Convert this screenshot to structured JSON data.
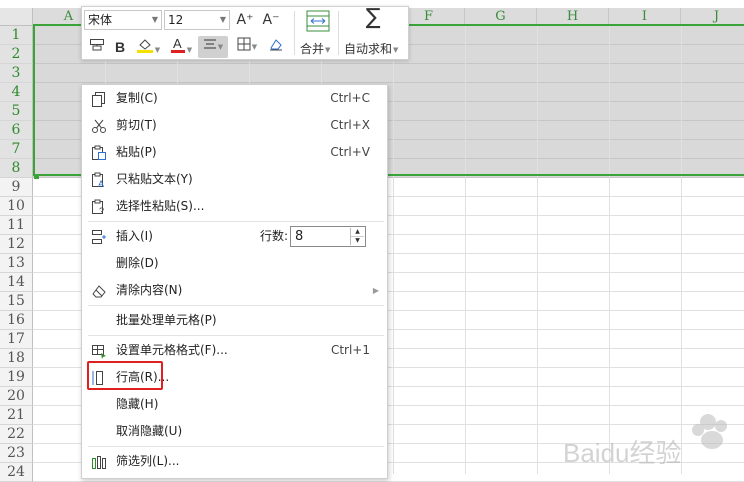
{
  "grid": {
    "columns": [
      "A",
      "",
      "",
      "",
      "",
      "F",
      "G",
      "H",
      "I",
      "J"
    ],
    "rows": [
      "1",
      "2",
      "3",
      "4",
      "5",
      "6",
      "7",
      "8",
      "9",
      "10",
      "11",
      "12",
      "13",
      "14",
      "15",
      "16",
      "17",
      "18",
      "19",
      "20",
      "21",
      "22",
      "23",
      "24"
    ],
    "selected_rows": [
      "1",
      "2",
      "3",
      "4",
      "5",
      "6",
      "7",
      "8"
    ]
  },
  "mini_toolbar": {
    "font_name": "宋体",
    "font_size": "12",
    "grow_font": "A⁺",
    "shrink_font": "A⁻",
    "bold": "B",
    "merge_label": "合并",
    "autosum_label": "自动求和",
    "sigma": "∑"
  },
  "context_menu": {
    "items": [
      {
        "label": "复制(C)",
        "shortcut": "Ctrl+C",
        "icon": "copy-icon"
      },
      {
        "label": "剪切(T)",
        "shortcut": "Ctrl+X",
        "icon": "scissors-icon"
      },
      {
        "label": "粘贴(P)",
        "shortcut": "Ctrl+V",
        "icon": "paste-icon"
      },
      {
        "label": "只粘贴文本(Y)",
        "shortcut": "",
        "icon": "paste-text-icon"
      },
      {
        "label": "选择性粘贴(S)...",
        "shortcut": "",
        "icon": "paste-special-icon"
      },
      {
        "label": "插入(I)",
        "shortcut": "",
        "icon": "insert-rows-icon"
      },
      {
        "label": "删除(D)",
        "shortcut": "",
        "icon": ""
      },
      {
        "label": "清除内容(N)",
        "shortcut": "",
        "icon": "eraser-icon"
      },
      {
        "label": "批量处理单元格(P)",
        "shortcut": "",
        "icon": ""
      },
      {
        "label": "设置单元格格式(F)...",
        "shortcut": "Ctrl+1",
        "icon": "format-cells-icon"
      },
      {
        "label": "行高(R)...",
        "shortcut": "",
        "icon": "row-height-icon"
      },
      {
        "label": "隐藏(H)",
        "shortcut": "",
        "icon": ""
      },
      {
        "label": "取消隐藏(U)",
        "shortcut": "",
        "icon": ""
      },
      {
        "label": "筛选列(L)...",
        "shortcut": "",
        "icon": "filter-columns-icon"
      }
    ],
    "insert_rows_label": "行数:",
    "insert_rows_value": "8"
  },
  "colors": {
    "selection_green": "#3aa43a",
    "highlight_red": "#e02020",
    "font_color_red": "#e02020",
    "highlight_yellow": "#f5e000"
  },
  "watermark": "Baidu经验"
}
